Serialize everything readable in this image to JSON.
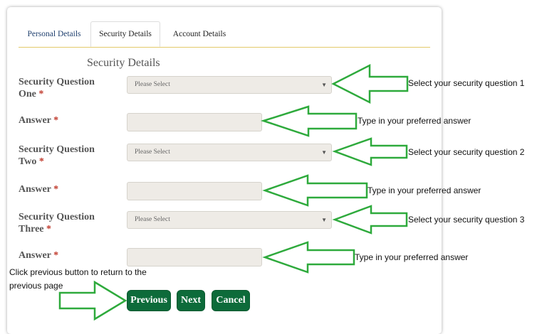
{
  "tabs": [
    {
      "label": "Personal Details"
    },
    {
      "label": "Security Details"
    },
    {
      "label": "Account Details"
    }
  ],
  "active_tab": "Security Details",
  "section_title": "Security Details",
  "form": {
    "q1_label": "Security Question One",
    "q1_value": "Please Select",
    "a1_label": "Answer",
    "q2_label": "Security Question Two",
    "q2_value": "Please Select",
    "a2_label": "Answer",
    "q3_label": "Security Question Three",
    "q3_value": "Please Select",
    "a3_label": "Answer",
    "required_mark": "*"
  },
  "buttons": {
    "previous": "Previous",
    "next": "Next",
    "cancel": "Cancel"
  },
  "annotations": {
    "q1": "Select your security question 1",
    "a1": "Type in your preferred answer",
    "q2": "Select your security question 2",
    "a2": "Type in your preferred answer",
    "q3": "Select your security question 3",
    "a3": "Type in your preferred answer",
    "previous": "Click previous button to return to the previous page"
  },
  "colors": {
    "button_green": "#0d6b3a",
    "arrow_green": "#2eaa3c",
    "tab_border": "#e3c96a",
    "field_bg": "#eeebe6"
  }
}
